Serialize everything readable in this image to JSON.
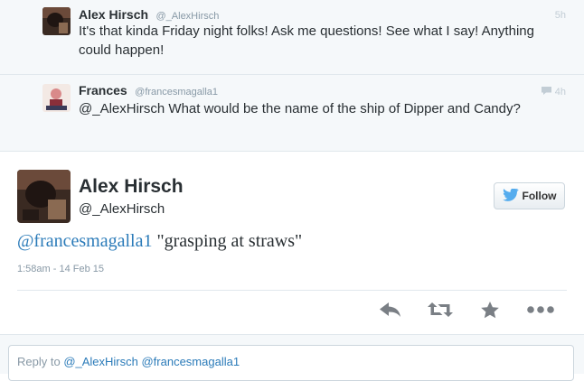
{
  "thread": {
    "tweets": [
      {
        "name": "Alex Hirsch",
        "handle": "@_AlexHirsch",
        "time": "5h",
        "text": "It's that kinda Friday night folks! Ask me questions! See what I say! Anything could happen!"
      },
      {
        "name": "Frances",
        "handle": "@francesmagalla1",
        "time": "4h",
        "text": "@_AlexHirsch What would be the name of the ship of Dipper and Candy?"
      }
    ]
  },
  "main_tweet": {
    "name": "Alex Hirsch",
    "handle": "@_AlexHirsch",
    "follow_label": "Follow",
    "mention": "@francesmagalla1",
    "text": " \"grasping at straws\"",
    "timestamp": "1:58am - 14 Feb 15"
  },
  "actions": {
    "icons": [
      "reply-icon",
      "retweet-icon",
      "favorite-icon",
      "more-icon"
    ]
  },
  "reply": {
    "prefix": "Reply to ",
    "mentions": "@_AlexHirsch @francesmagalla1"
  },
  "colors": {
    "link": "#2b7bb9",
    "twitter_blue": "#55acee",
    "muted": "#8899a6",
    "action_icon": "#7a7f85"
  }
}
